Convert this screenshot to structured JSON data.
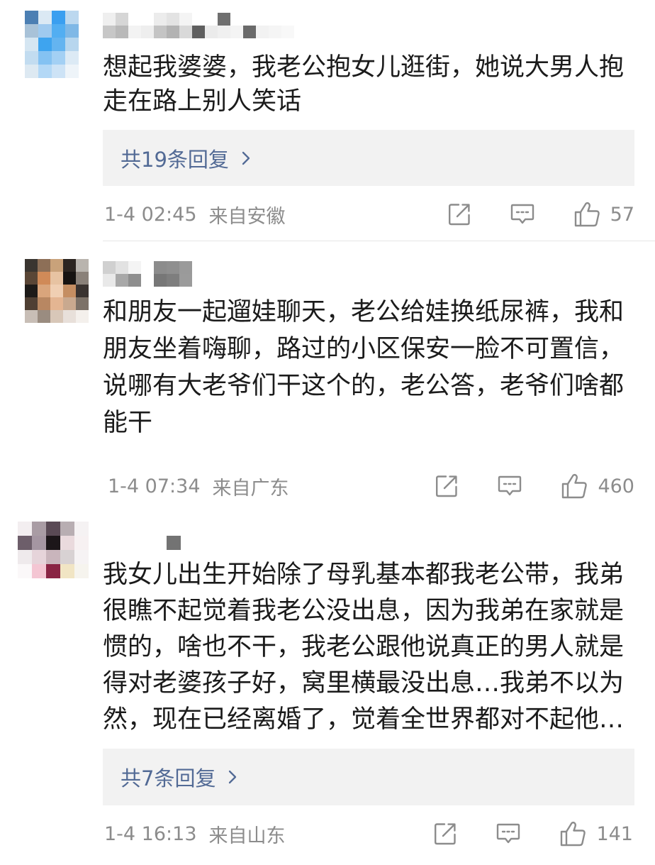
{
  "colors": {
    "text": "#1b1b1b",
    "meta": "#8c8c8c",
    "reply_text": "#526a95",
    "reply_bg": "#f2f2f2",
    "divider": "#e6e6e6",
    "icon": "#8c8c8c"
  },
  "icons": {
    "share": "share-icon",
    "comment": "comment-icon",
    "like": "thumbs-up-icon",
    "more_replies": "chevron-right-icon"
  },
  "comments": [
    {
      "avatar_mosaic": [
        [
          "#4c7fb3",
          "#dbe9f4",
          "#3a9ff0",
          "#bcd8ef"
        ],
        [
          "#a8c2d8",
          "#9fcaef",
          "#52aef2",
          "#7fb8e6"
        ],
        [
          "#d5e6f2",
          "#3ea4ef",
          "#64b4f0",
          "#b7d6ee"
        ],
        [
          "#c2dcf0",
          "#84c2f2",
          "#a3d0f4",
          "#dceaf5"
        ],
        [
          "#dde9f2",
          "#b3d8f6",
          "#cde3f6",
          "#eef4f9"
        ]
      ],
      "username_mosaic": [
        [
          "#efefef",
          "#d6d6d6",
          "#ffffff",
          "#ffffff",
          "#ececec",
          "#e3e3e3",
          "#f4f4f4",
          "#ffffff",
          "#ffffff",
          "#6f6f6f",
          "#ffffff",
          "#ffffff",
          "#ffffff",
          "#ffffff",
          "#ffffff"
        ],
        [
          "#c7c7c7",
          "#b9b9b9",
          "#f3f3f3",
          "#eeeeee",
          "#c4c4c4",
          "#b3b3b3",
          "#d9d9d9",
          "#5f5f5f",
          "#ebebeb",
          "#f0f0f0",
          "#f4f4f4",
          "#6a6a6a",
          "#f2f2f2",
          "#f5f5f5",
          "#f8f8f8"
        ]
      ],
      "text_lines": [
        "想起我婆婆，我老公抱女儿逛街，她说大男人抱",
        "走在路上别人笑话"
      ],
      "replies_label": "共19条回复",
      "time": "1-4 02:45",
      "location": "来自安徽",
      "likes": "57"
    },
    {
      "avatar_mosaic": [
        [
          "#3a3530",
          "#8d6f57",
          "#c9a27a",
          "#2c2521",
          "#b9b4ae"
        ],
        [
          "#5a4636",
          "#d08a58",
          "#e7c3a2",
          "#171311",
          "#8a8179"
        ],
        [
          "#1d1a18",
          "#d9a57c",
          "#f0cfb3",
          "#c58e62",
          "#3a3330"
        ],
        [
          "#4f3f33",
          "#b88762",
          "#e4b592",
          "#c9a98f",
          "#7d7268"
        ],
        [
          "#c8beb6",
          "#9a8c80",
          "#d8c7b8",
          "#e8e0da",
          "#f4f0ec"
        ]
      ],
      "username_mosaic": [
        [
          "#d0d0d0",
          "#e2e2e2",
          "#f4f4f4",
          "#ffffff",
          "#8c8c8c",
          "#8f8f8f",
          "#9a9a9a"
        ],
        [
          "#e9e9e9",
          "#a8a8a8",
          "#8e8e8e",
          "#ffffff",
          "#777777",
          "#7e7e7e",
          "#9b9b9b"
        ]
      ],
      "text_lines": [
        "和朋友一起遛娃聊天，老公给娃换纸尿裤，我和",
        "朋友坐着嗨聊，路过的小区保安一脸不可置信，",
        "说哪有大老爷们干这个的，老公答，老爷们啥都",
        "能干"
      ],
      "time": "1-4 07:34",
      "location": "来自广东",
      "likes": "460"
    },
    {
      "avatar_mosaic": [
        [
          "#f3eef0",
          "#a99ca4",
          "#5a4a55",
          "#b8aeb2",
          "#f5f2f3"
        ],
        [
          "#6d5e6a",
          "#a596a2",
          "#1c1619",
          "#eadadd",
          "#f7f1f2"
        ],
        [
          "#efeaec",
          "#e6d4da",
          "#c9b5bc",
          "#d8d2d3",
          "#f6f3f4"
        ],
        [
          "#fbf8f9",
          "#f4c6d3",
          "#8a2444",
          "#f1e5c4",
          "#f6f4ee"
        ]
      ],
      "username_mosaic": [
        [
          "#737373"
        ]
      ],
      "text_lines": [
        "我女儿出生开始除了母乳基本都我老公带，我弟",
        "很瞧不起觉着我老公没出息，因为我弟在家就是",
        "惯的，啥也不干，我老公跟他说真正的男人就是",
        "得对老婆孩子好，窝里横最没出息…我弟不以为",
        "然，现在已经离婚了，觉着全世界都对不起他…"
      ],
      "replies_label": "共7条回复",
      "time": "1-4 16:13",
      "location": "来自山东",
      "likes": "141"
    }
  ]
}
